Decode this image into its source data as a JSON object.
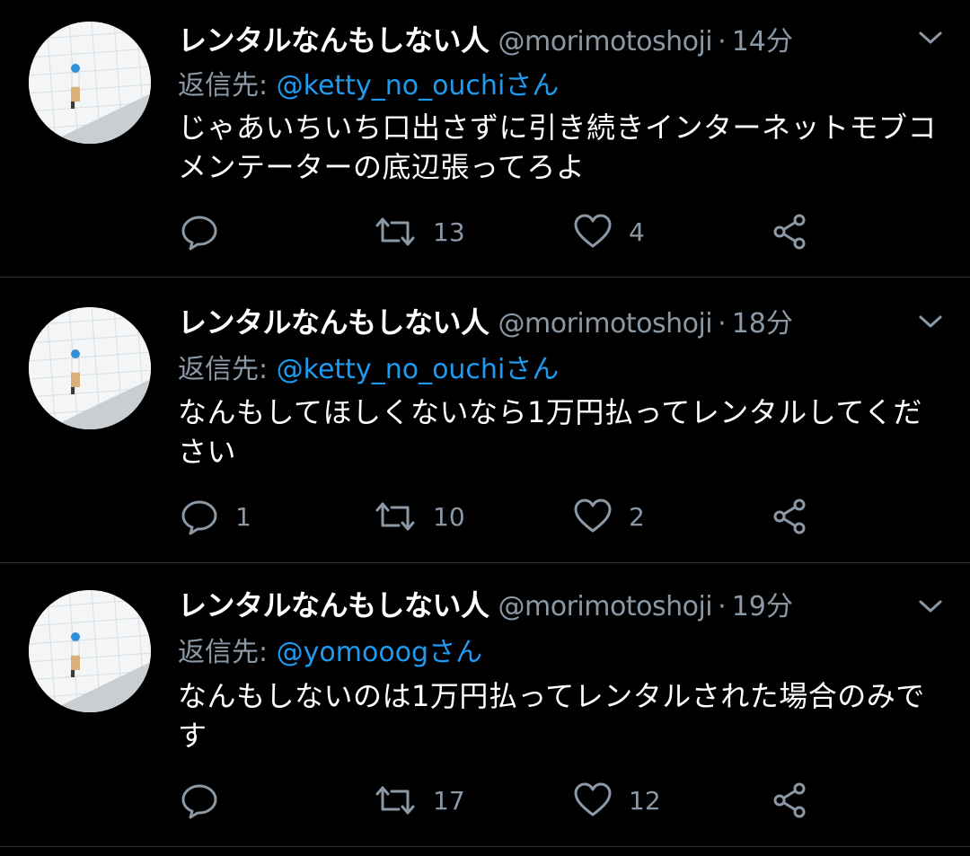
{
  "tweets": [
    {
      "name": "レンタルなんもしない人",
      "handle": "@morimotoshoji",
      "separator": "·",
      "time": "14分",
      "reply_prefix": "返信先: ",
      "reply_handle": "@ketty_no_ouchiさん",
      "text": "じゃあいちいち口出さずに引き続きインターネットモブコメンテーターの底辺張ってろよ",
      "reply_count": "",
      "retweet_count": "13",
      "like_count": "4"
    },
    {
      "name": "レンタルなんもしない人",
      "handle": "@morimotoshoji",
      "separator": "·",
      "time": "18分",
      "reply_prefix": "返信先: ",
      "reply_handle": "@ketty_no_ouchiさん",
      "text": "なんもしてほしくないなら1万円払ってレンタルしてください",
      "reply_count": "1",
      "retweet_count": "10",
      "like_count": "2"
    },
    {
      "name": "レンタルなんもしない人",
      "handle": "@morimotoshoji",
      "separator": "·",
      "time": "19分",
      "reply_prefix": "返信先: ",
      "reply_handle": "@yomooogさん",
      "text": "なんもしないのは1万円払ってレンタルされた場合のみです",
      "reply_count": "",
      "retweet_count": "17",
      "like_count": "12"
    }
  ],
  "icons": {
    "caret": "chevron-down-icon",
    "reply": "reply-bubble-icon",
    "retweet": "retweet-icon",
    "like": "heart-icon",
    "share": "share-icon"
  },
  "colors": {
    "background": "#000000",
    "text": "#ffffff",
    "muted": "#8b98a5",
    "link": "#1d9bf0",
    "divider": "#2f3336"
  }
}
